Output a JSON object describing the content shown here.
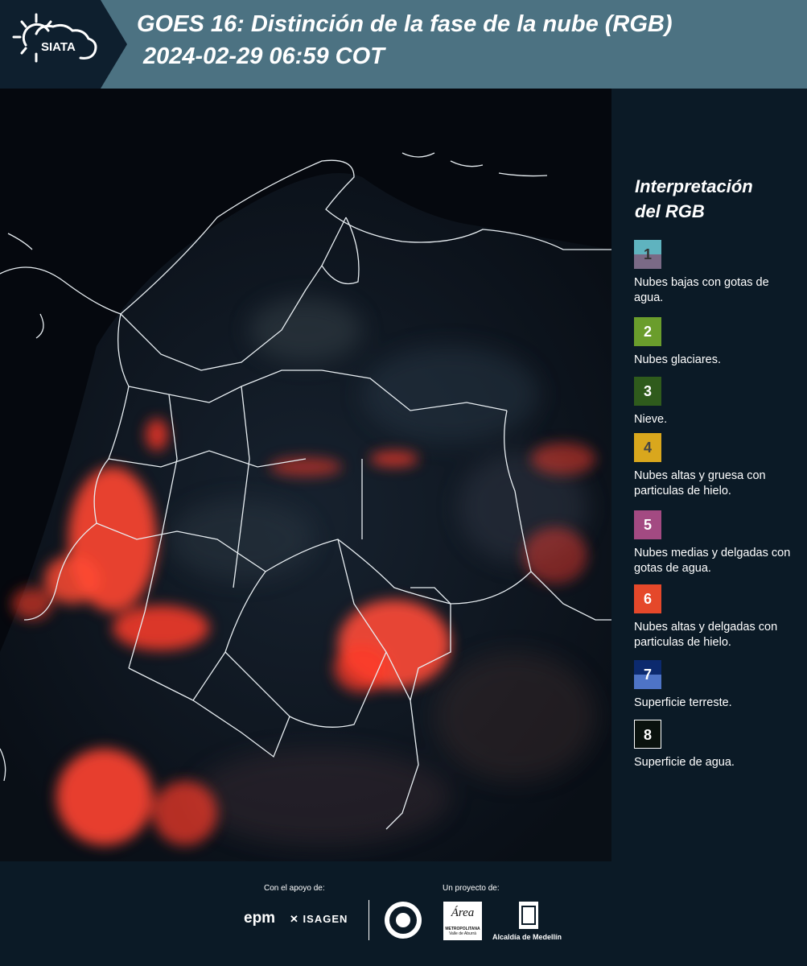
{
  "header": {
    "logo_text": "SIATA",
    "title_line1": "GOES 16: Distinción de la fase de la nube (RGB)",
    "title_line2": "2024-02-29 06:59 COT"
  },
  "legend": {
    "title_line1": "Interpretación",
    "title_line2": "del RGB",
    "items": [
      {
        "num": "1",
        "desc": "Nubes bajas con gotas de agua.",
        "color_top": "#5fb3bf",
        "color_bottom": "#7a6a86"
      },
      {
        "num": "2",
        "desc": "Nubes glaciares.",
        "color_top": "#6a9d2c",
        "color_bottom": "#6a9d2c"
      },
      {
        "num": "3",
        "desc": "Nieve.",
        "color_top": "#2f5b1c",
        "color_bottom": "#2f5b1c"
      },
      {
        "num": "4",
        "desc": "Nubes altas y gruesa con particulas de hielo.",
        "color_top": "#d9a71d",
        "color_bottom": "#d9a71d"
      },
      {
        "num": "5",
        "desc": "Nubes medias y delgadas con gotas de agua.",
        "color_top": "#a34a82",
        "color_bottom": "#a34a82"
      },
      {
        "num": "6",
        "desc": "Nubes altas y delgadas con particulas de hielo.",
        "color_top": "#e5482a",
        "color_bottom": "#e5482a"
      },
      {
        "num": "7",
        "desc": "Superficie terreste.",
        "color_top": "#0c2a6e",
        "color_bottom": "#4e74c6"
      },
      {
        "num": "8",
        "desc": "Superficie de agua.",
        "color_top": "#0a120e",
        "color_bottom": "#0a120e"
      }
    ]
  },
  "footer": {
    "support_label": "Con el apoyo de:",
    "project_label": "Un proyecto de:",
    "sponsor1": "epm",
    "sponsor2": "ISAGEN",
    "partner1_line1": "METROPOLITANA",
    "partner1_line2": "Valle de Aburrá",
    "partner1_script": "Área",
    "partner2": "Alcaldía de Medellín"
  }
}
